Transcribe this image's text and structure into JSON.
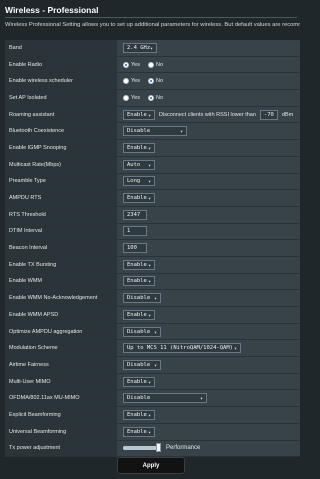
{
  "title": "Wireless - Professional",
  "description": "Wireless Professional Setting allows you to set up additional parameters for wireless. But default values are recommende",
  "colors": {
    "background": "#1f272a",
    "label_cell": "#2b3439",
    "value_cell": "#384349",
    "apply_button": "#121212"
  },
  "rows": [
    {
      "label": "Band",
      "type": "select",
      "value": "2.4 GHz"
    },
    {
      "label": "Enable Radio",
      "type": "radio",
      "options": [
        "Yes",
        "No"
      ],
      "selected": "Yes"
    },
    {
      "label": "Enable wireless scheduler",
      "type": "radio",
      "options": [
        "Yes",
        "No"
      ],
      "selected": "No"
    },
    {
      "label": "Set AP Isolated",
      "type": "radio",
      "options": [
        "Yes",
        "No"
      ],
      "selected": "No"
    },
    {
      "label": "Roaming assistant",
      "type": "roaming",
      "value": "Enable",
      "text": "Disconnect clients with RSSI lower than",
      "rssi": "-70",
      "unit": "dBm"
    },
    {
      "label": "Bluetooth Coexistence",
      "type": "select",
      "value": "Disable"
    },
    {
      "label": "Enable IGMP Snooping",
      "type": "select",
      "value": "Enable"
    },
    {
      "label": "Multicast Rate(Mbps)",
      "type": "select",
      "value": "Auto"
    },
    {
      "label": "Preamble Type",
      "type": "select",
      "value": "Long"
    },
    {
      "label": "AMPDU RTS",
      "type": "select",
      "value": "Enable"
    },
    {
      "label": "RTS Threshold",
      "type": "text",
      "value": "2347"
    },
    {
      "label": "DTIM Interval",
      "type": "text",
      "value": "1"
    },
    {
      "label": "Beacon Interval",
      "type": "text",
      "value": "100"
    },
    {
      "label": "Enable TX Bursting",
      "type": "select",
      "value": "Enable"
    },
    {
      "label": "Enable WMM",
      "type": "select",
      "value": "Enable"
    },
    {
      "label": "Enable WMM No-Acknowledgement",
      "type": "select",
      "value": "Disable"
    },
    {
      "label": "Enable WMM APSD",
      "type": "select",
      "value": "Enable"
    },
    {
      "label": "Optimize AMPDU aggregation",
      "type": "select",
      "value": "Disable"
    },
    {
      "label": "Modulation Scheme",
      "type": "select",
      "value": "Up to MCS 11 (NitroQAM/1024-QAM)"
    },
    {
      "label": "Airtime Fairness",
      "type": "select",
      "value": "Disable"
    },
    {
      "label": "Multi-User MIMO",
      "type": "select",
      "value": "Enable"
    },
    {
      "label": "OFDMA/802.11ax MU-MIMO",
      "type": "select",
      "value": "Disable"
    },
    {
      "label": "Explicit Beamforming",
      "type": "select",
      "value": "Enable"
    },
    {
      "label": "Universal Beamforming",
      "type": "select",
      "value": "Enable"
    },
    {
      "label": "Tx power adjustment",
      "type": "slider",
      "level": 1.0,
      "text": "Performance"
    }
  ],
  "apply_label": "Apply"
}
